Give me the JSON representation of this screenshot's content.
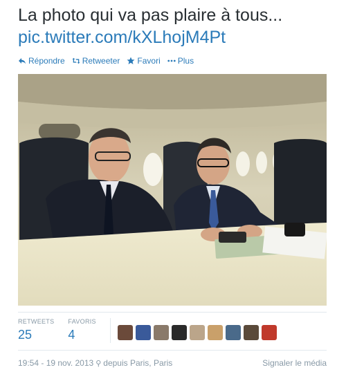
{
  "tweet": {
    "text": "La photo qui va pas plaire à tous...",
    "link": "pic.twitter.com/kXLhojM4Pt"
  },
  "actions": [
    {
      "label": "Répondre",
      "icon": "reply-icon"
    },
    {
      "label": "Retweeter",
      "icon": "retweet-icon"
    },
    {
      "label": "Favori",
      "icon": "star-icon"
    },
    {
      "label": "Plus",
      "icon": "more-icon"
    }
  ],
  "stats": {
    "retweets_label": "RETWEETS",
    "retweets_value": "25",
    "favoris_label": "FAVORIS",
    "favoris_value": "4"
  },
  "avatars": [
    {
      "color": "#6b4a3a"
    },
    {
      "color": "#3a5a9a"
    },
    {
      "color": "#8a7a6a"
    },
    {
      "color": "#2a2a2a"
    },
    {
      "color": "#bba58a"
    },
    {
      "color": "#c9a06a"
    },
    {
      "color": "#4a6a8a"
    },
    {
      "color": "#5a4a3a"
    },
    {
      "color": "#c0392b"
    }
  ],
  "footer": {
    "timestamp": "19:54 - 19 nov. 2013",
    "location": "depuis Paris, Paris",
    "report": "Signaler le média"
  },
  "colors": {
    "link": "#2b7bb9",
    "muted": "#8899a6"
  }
}
